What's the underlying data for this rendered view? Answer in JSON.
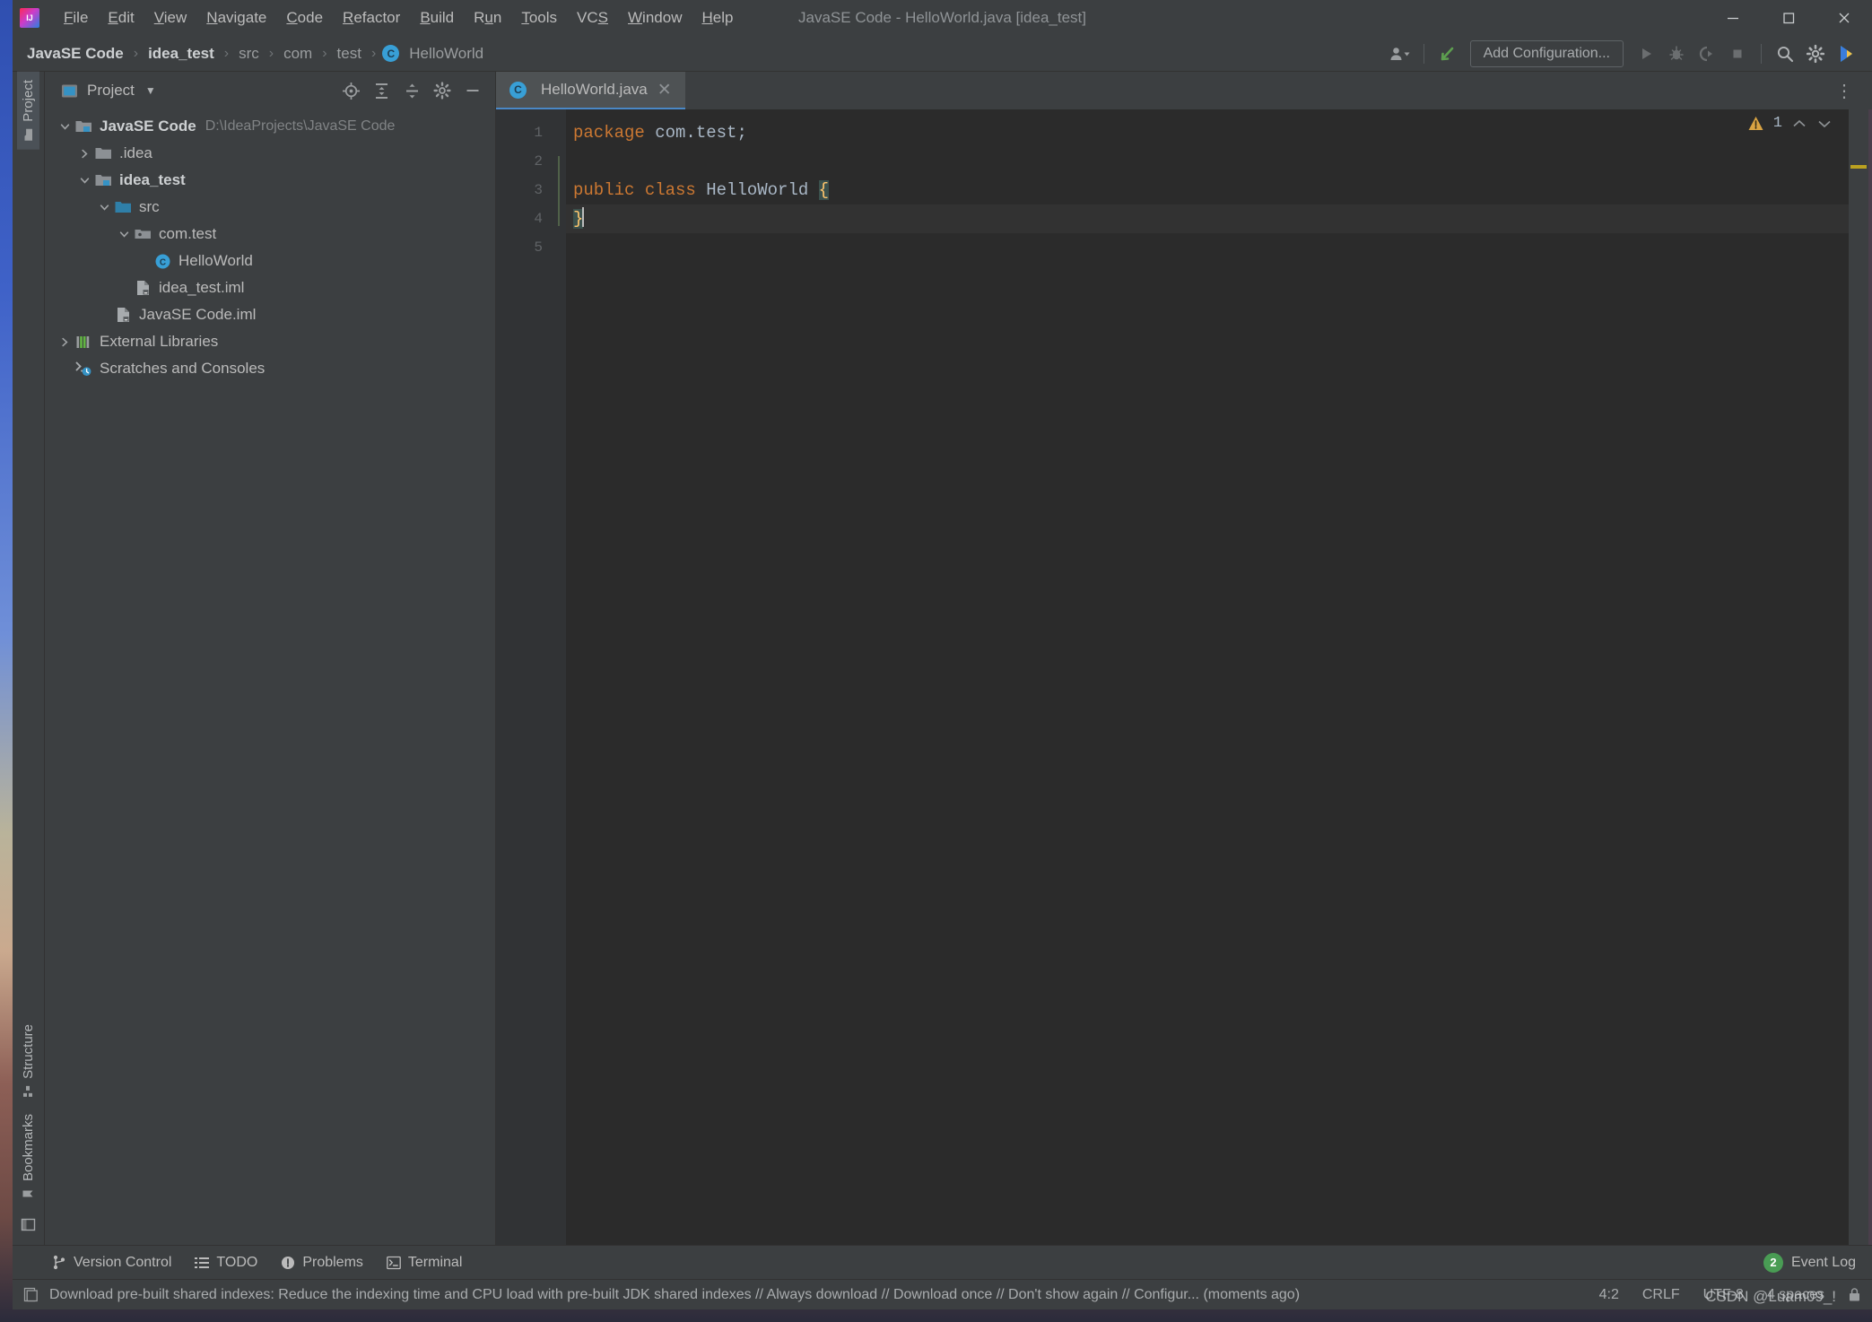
{
  "window": {
    "title": "JavaSE Code - HelloWorld.java [idea_test]",
    "logo_icon": "intellij-idea-logo",
    "minimize_icon": "minimize-icon",
    "maximize_icon": "maximize-icon",
    "close_icon": "close-icon"
  },
  "menubar": {
    "items": [
      {
        "label": "File",
        "mnemonic": "F"
      },
      {
        "label": "Edit",
        "mnemonic": "E"
      },
      {
        "label": "View",
        "mnemonic": "V"
      },
      {
        "label": "Navigate",
        "mnemonic": "N"
      },
      {
        "label": "Code",
        "mnemonic": "C"
      },
      {
        "label": "Refactor",
        "mnemonic": "R"
      },
      {
        "label": "Build",
        "mnemonic": "B"
      },
      {
        "label": "Run",
        "mnemonic": "u"
      },
      {
        "label": "Tools",
        "mnemonic": "T"
      },
      {
        "label": "VCS",
        "mnemonic": "S"
      },
      {
        "label": "Window",
        "mnemonic": "W"
      },
      {
        "label": "Help",
        "mnemonic": "H"
      }
    ]
  },
  "navbar": {
    "breadcrumbs": [
      {
        "label": "JavaSE Code",
        "style": "bold"
      },
      {
        "label": "idea_test",
        "style": "bold"
      },
      {
        "label": "src",
        "style": "dim"
      },
      {
        "label": "com",
        "style": "dim"
      },
      {
        "label": "test",
        "style": "dim"
      },
      {
        "label": "HelloWorld",
        "style": "dim",
        "icon": "class-icon",
        "icon_letter": "C"
      }
    ],
    "separator": "›",
    "run_config_label": "Add Configuration...",
    "icons": {
      "user_icon": "user-dropdown-icon",
      "update_icon": "update-project-icon",
      "run_icon": "run-icon",
      "debug_icon": "debug-icon",
      "coverage_icon": "run-with-coverage-icon",
      "stop_icon": "stop-icon",
      "search_icon": "search-everywhere-icon",
      "settings_icon": "settings-gear-icon",
      "ide_icon": "ide-helper-icon"
    }
  },
  "left_strip": {
    "top": [
      {
        "label": "Project",
        "icon": "project-folder-icon",
        "active": true
      }
    ],
    "bottom": [
      {
        "label": "Structure",
        "icon": "structure-icon"
      },
      {
        "label": "Bookmarks",
        "icon": "bookmarks-icon"
      }
    ],
    "bottom_icon": "terminal-window-icon"
  },
  "project_panel": {
    "title": "Project",
    "title_icon": "project-view-icon",
    "dropdown_icon": "chevron-down-icon",
    "tools": [
      {
        "icon": "locate-target-icon",
        "name": "select-opened-file"
      },
      {
        "icon": "expand-all-icon",
        "name": "expand-all"
      },
      {
        "icon": "collapse-all-icon",
        "name": "collapse-all"
      },
      {
        "icon": "gear-icon",
        "name": "panel-settings"
      },
      {
        "icon": "minus-icon",
        "name": "hide-panel"
      }
    ],
    "tree": [
      {
        "depth": 0,
        "arrow": "down",
        "icon": "module-root-icon",
        "label": "JavaSE Code",
        "bold": true,
        "path": "D:\\IdeaProjects\\JavaSE Code"
      },
      {
        "depth": 1,
        "arrow": "right",
        "icon": "folder-icon",
        "label": ".idea",
        "bold": false,
        "path": ""
      },
      {
        "depth": 1,
        "arrow": "down",
        "icon": "module-icon",
        "label": "idea_test",
        "bold": true,
        "path": ""
      },
      {
        "depth": 2,
        "arrow": "down",
        "icon": "source-folder-icon",
        "label": "src",
        "bold": false,
        "path": ""
      },
      {
        "depth": 3,
        "arrow": "down",
        "icon": "package-icon",
        "label": "com.test",
        "bold": false,
        "path": ""
      },
      {
        "depth": 4,
        "arrow": "none",
        "icon": "class-icon",
        "label": "HelloWorld",
        "bold": false,
        "path": ""
      },
      {
        "depth": 3,
        "arrow": "none",
        "icon": "iml-file-icon",
        "label": "idea_test.iml",
        "bold": false,
        "path": ""
      },
      {
        "depth": 2,
        "arrow": "none",
        "icon": "iml-file-icon",
        "label": "JavaSE Code.iml",
        "bold": false,
        "path": ""
      },
      {
        "depth": 0,
        "arrow": "right",
        "icon": "libraries-icon",
        "label": "External Libraries",
        "bold": false,
        "path": ""
      },
      {
        "depth": 0,
        "arrow": "none",
        "icon": "scratches-icon",
        "label": "Scratches and Consoles",
        "bold": false,
        "path": ""
      }
    ]
  },
  "editor": {
    "tab": {
      "label": "HelloWorld.java",
      "icon": "java-class-icon",
      "icon_letter": "C",
      "close_icon": "close-icon"
    },
    "tab_overflow_icon": "more-options-icon",
    "inspection": {
      "count": "1",
      "icon": "warning-triangle-icon",
      "up_icon": "chevron-up-icon",
      "down_icon": "chevron-down-icon"
    },
    "line_numbers": [
      "1",
      "2",
      "3",
      "4",
      "5"
    ],
    "lines": [
      {
        "n": 1,
        "current": false,
        "tokens": [
          {
            "t": "package",
            "c": "kw"
          },
          {
            "t": " com.test;",
            "c": "pl"
          }
        ]
      },
      {
        "n": 2,
        "current": false,
        "tokens": []
      },
      {
        "n": 3,
        "current": false,
        "tokens": [
          {
            "t": "public",
            "c": "kw"
          },
          {
            "t": " ",
            "c": "pl"
          },
          {
            "t": "class",
            "c": "kw"
          },
          {
            "t": " HelloWorld ",
            "c": "type"
          },
          {
            "t": "{",
            "c": "brace-hl"
          }
        ]
      },
      {
        "n": 4,
        "current": true,
        "tokens": [
          {
            "t": "}",
            "c": "brace-hl"
          },
          {
            "t": "caret",
            "c": "caret"
          }
        ]
      },
      {
        "n": 5,
        "current": false,
        "tokens": []
      }
    ]
  },
  "bottom_toolbar": {
    "tabs": [
      {
        "label": "Version Control",
        "icon": "branch-icon"
      },
      {
        "label": "TODO",
        "icon": "todo-list-icon"
      },
      {
        "label": "Problems",
        "icon": "problems-icon"
      },
      {
        "label": "Terminal",
        "icon": "terminal-icon"
      }
    ],
    "event_log": {
      "label": "Event Log",
      "count": "2"
    }
  },
  "statusbar": {
    "message_icon": "notification-icon",
    "message": "Download pre-built shared indexes: Reduce the indexing time and CPU load with pre-built JDK shared indexes // Always download // Download once // Don't show again // Configur... (moments ago)",
    "caret_position": "4:2",
    "line_separator": "CRLF",
    "encoding": "UTF-8",
    "indent": "4 spaces",
    "lock_icon": "lock-icon"
  },
  "watermark": {
    "text": "CSDN @Luam09_!"
  },
  "colors": {
    "accent_blue": "#4a88c7",
    "panel_bg": "#3c3f41",
    "editor_bg": "#2b2b2b",
    "gutter_bg": "#313335",
    "keyword_orange": "#cc7832",
    "text_grey": "#a9b7c6",
    "warning_yellow": "#bba120",
    "badge_green": "#499c54",
    "class_icon_blue": "#389fd6"
  }
}
